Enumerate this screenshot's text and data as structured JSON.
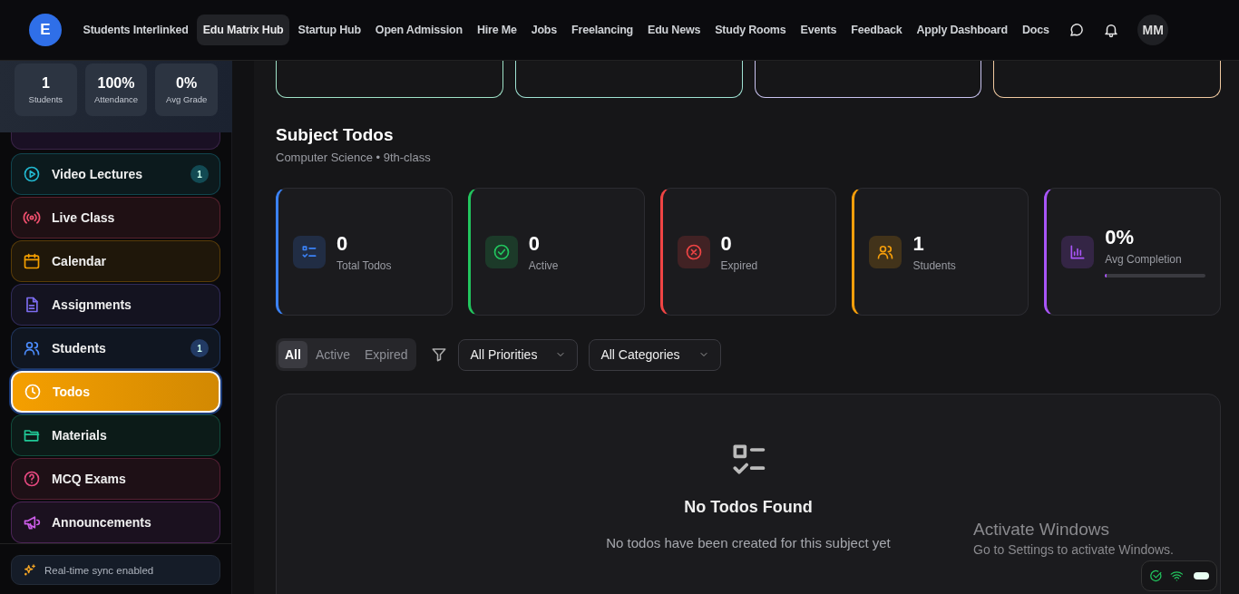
{
  "nav": {
    "logo": "E",
    "links": [
      {
        "label": "Students Interlinked",
        "selected": false
      },
      {
        "label": "Edu Matrix Hub",
        "selected": true
      },
      {
        "label": "Startup Hub",
        "selected": false
      },
      {
        "label": "Open Admission",
        "selected": false
      },
      {
        "label": "Hire Me",
        "selected": false
      },
      {
        "label": "Jobs",
        "selected": false
      },
      {
        "label": "Freelancing",
        "selected": false
      },
      {
        "label": "Edu News",
        "selected": false
      },
      {
        "label": "Study Rooms",
        "selected": false
      },
      {
        "label": "Events",
        "selected": false
      },
      {
        "label": "Feedback",
        "selected": false
      },
      {
        "label": "Apply Dashboard",
        "selected": false
      },
      {
        "label": "Docs",
        "selected": false
      }
    ],
    "avatar": "MM"
  },
  "sidebar": {
    "stats": [
      {
        "value": "1",
        "label": "Students"
      },
      {
        "value": "100%",
        "label": "Attendance"
      },
      {
        "value": "0%",
        "label": "Avg Grade"
      }
    ],
    "items": [
      {
        "label": "Video Lectures",
        "color": "#22b8cf",
        "badge": "1",
        "selected": false
      },
      {
        "label": "Live Class",
        "color": "#f0506e",
        "selected": false
      },
      {
        "label": "Calendar",
        "color": "#f59f00",
        "selected": false
      },
      {
        "label": "Assignments",
        "color": "#7c6cf0",
        "selected": false
      },
      {
        "label": "Students",
        "color": "#4c8dff",
        "badge": "1",
        "selected": false
      },
      {
        "label": "Todos",
        "color": "#f59f00",
        "selected": true
      },
      {
        "label": "Materials",
        "color": "#20c997",
        "selected": false
      },
      {
        "label": "MCQ Exams",
        "color": "#e64980",
        "selected": false
      },
      {
        "label": "Announcements",
        "color": "#cc5de8",
        "selected": false
      }
    ],
    "sync": "Real-time sync enabled"
  },
  "top_cards": [
    {
      "color": "#9fe3c8"
    },
    {
      "color": "#9fe3d4"
    },
    {
      "color": "#c9c3f0"
    },
    {
      "color": "#f0c9a0"
    }
  ],
  "header": {
    "title": "Subject Todos",
    "subtitle": "Computer Science • 9th-class"
  },
  "stats": [
    {
      "value": "0",
      "label": "Total Todos",
      "color": "#3b82f6"
    },
    {
      "value": "0",
      "label": "Active",
      "color": "#22c55e"
    },
    {
      "value": "0",
      "label": "Expired",
      "color": "#ef4444"
    },
    {
      "value": "1",
      "label": "Students",
      "color": "#f59e0b"
    },
    {
      "value": "0%",
      "label": "Avg Completion",
      "color": "#a855f7",
      "level": 0
    }
  ],
  "filters": {
    "tabs": [
      {
        "label": "All",
        "selected": true
      },
      {
        "label": "Active",
        "selected": false
      },
      {
        "label": "Expired",
        "selected": false
      }
    ],
    "dropdowns": [
      "All Priorities",
      "All Categories"
    ]
  },
  "empty": {
    "title": "No Todos Found",
    "message": "No todos have been created for this subject yet"
  },
  "os_overlay": {
    "title": "Activate Windows",
    "message": "Go to Settings to activate Windows."
  }
}
